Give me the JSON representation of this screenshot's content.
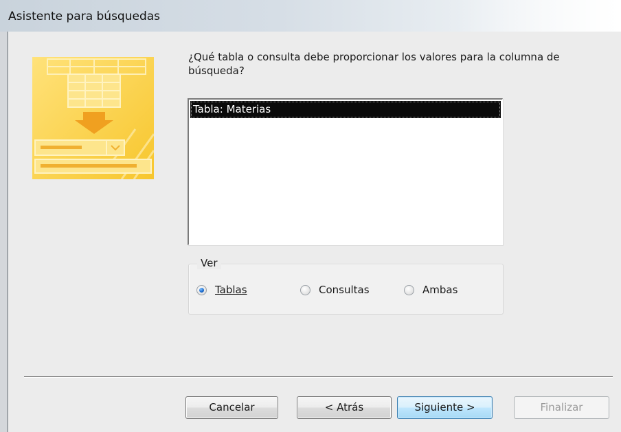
{
  "window": {
    "title": "Asistente para búsquedas"
  },
  "prompt": {
    "line1": "¿Qué tabla o consulta debe proporcionar los valores para la columna de",
    "line2": "búsqueda?"
  },
  "list": {
    "items": [
      {
        "label": "Tabla: Materias",
        "selected": true
      }
    ]
  },
  "view_group": {
    "label": "Ver",
    "options": [
      {
        "label": "Tablas",
        "checked": true
      },
      {
        "label": "Consultas",
        "checked": false
      },
      {
        "label": "Ambas",
        "checked": false
      }
    ]
  },
  "buttons": {
    "cancel": "Cancelar",
    "back": "< Atrás",
    "next": "Siguiente >",
    "finish": "Finalizar"
  },
  "colors": {
    "accent_yellow": "#f5c93a",
    "selection": "#0a0a0a",
    "default_button_border": "#3c7fb1"
  }
}
